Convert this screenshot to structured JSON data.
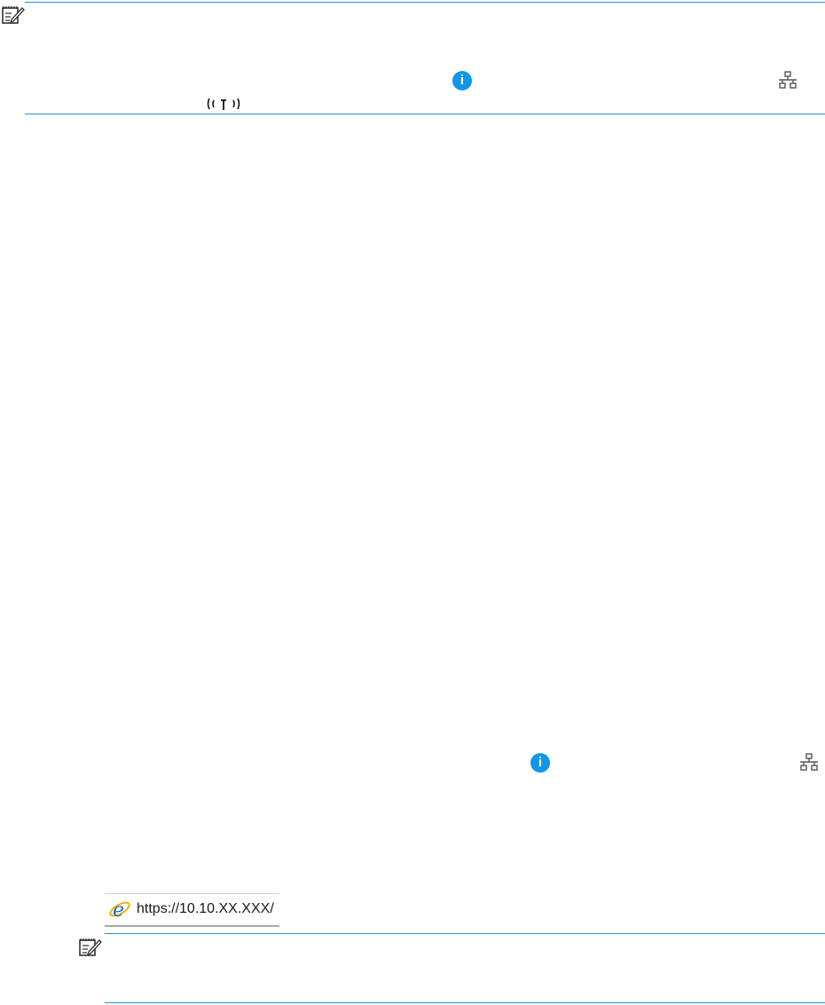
{
  "note_top": {
    "icon": "note-icon"
  },
  "address_bar": {
    "url": "https://10.10.XX.XXX/",
    "browser_icon": "internet-explorer-icon"
  },
  "note_bottom": {
    "icon": "note-icon"
  },
  "colors": {
    "rule": "#2b8fd6",
    "info": "#1296e8",
    "icon_gray": "#555555"
  }
}
